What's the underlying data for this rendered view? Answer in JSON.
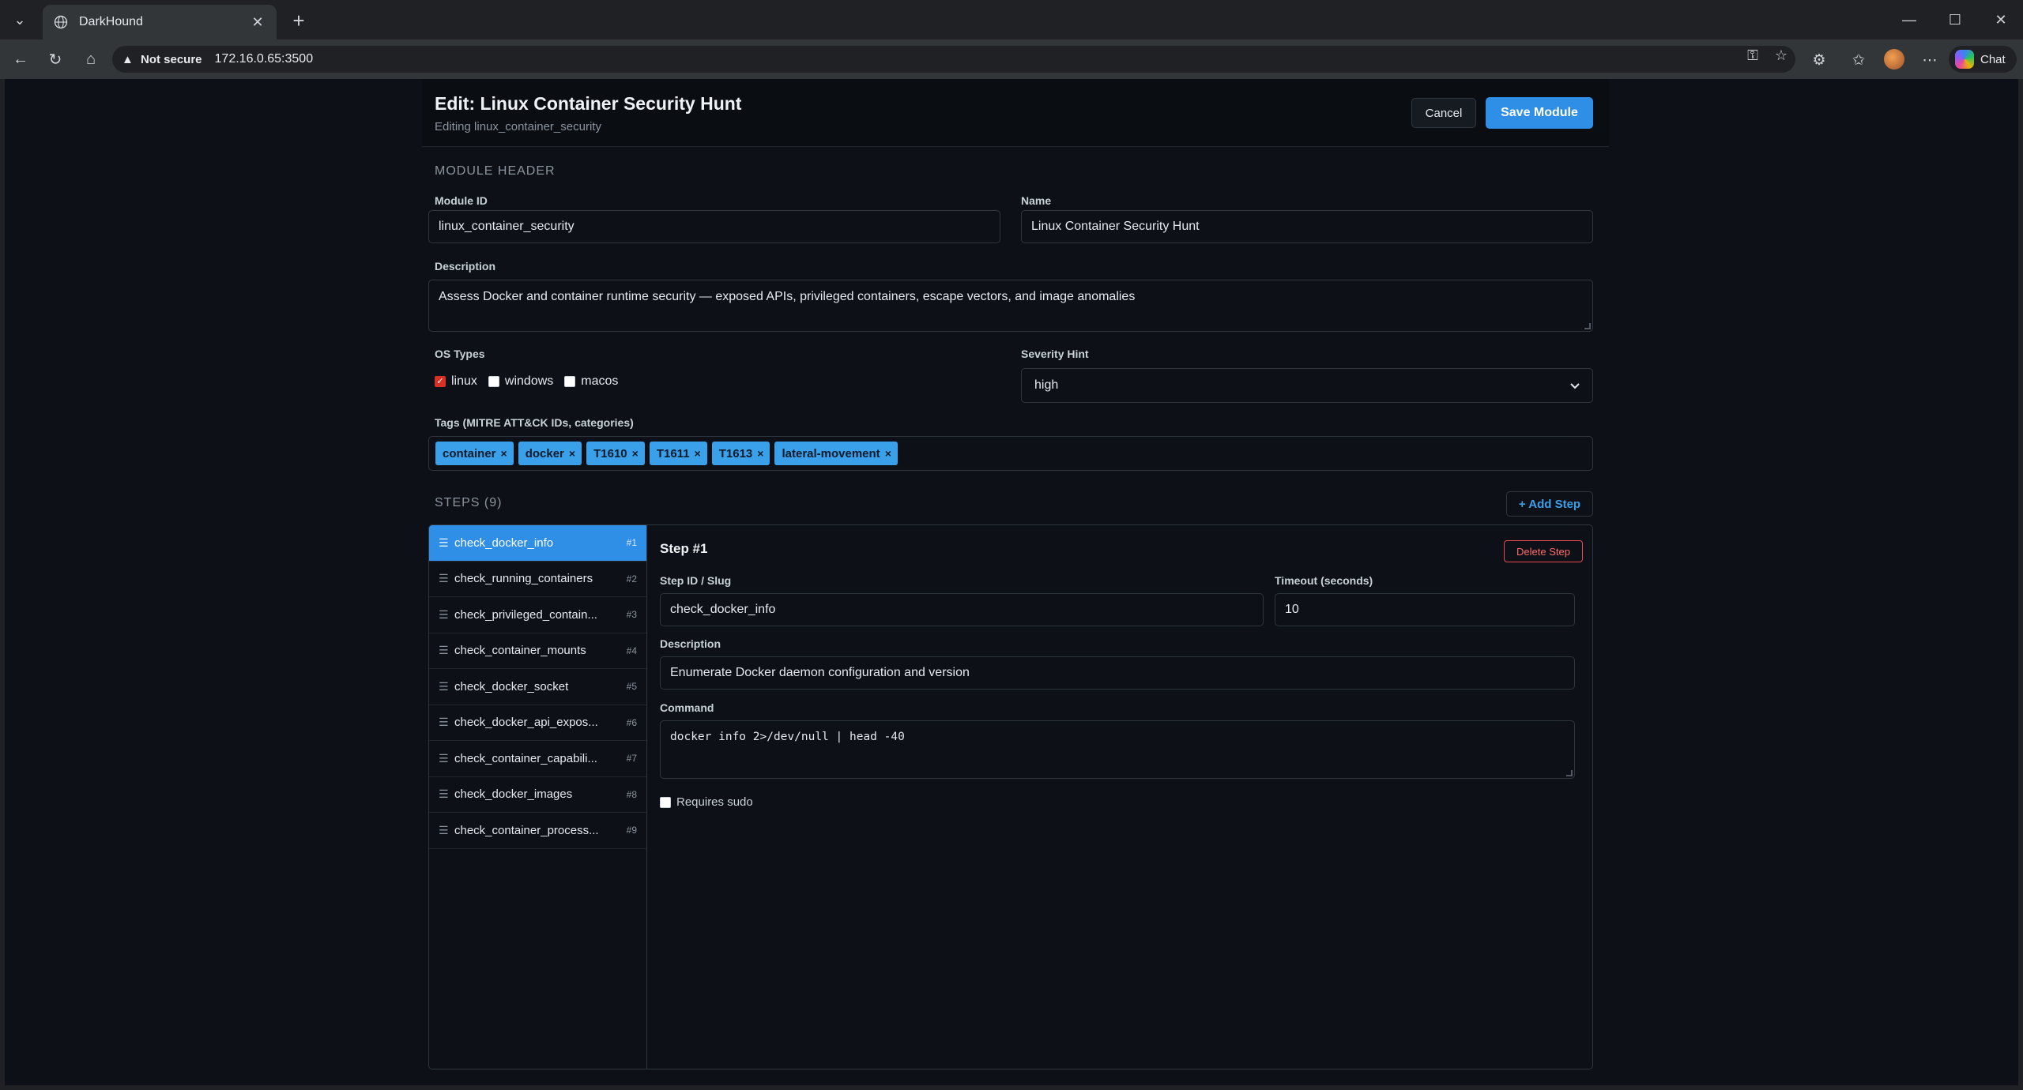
{
  "browser": {
    "tab_title": "DarkHound",
    "security_label": "Not secure",
    "url": "172.16.0.65:3500",
    "chat_label": "Chat"
  },
  "header": {
    "title": "Edit: Linux Container Security Hunt",
    "subtitle": "Editing linux_container_security",
    "cancel_label": "Cancel",
    "save_label": "Save Module"
  },
  "module": {
    "section_title": "MODULE HEADER",
    "id_label": "Module ID",
    "id_value": "linux_container_security",
    "name_label": "Name",
    "name_value": "Linux Container Security Hunt",
    "description_label": "Description",
    "description_value": "Assess Docker and container runtime security — exposed APIs, privileged containers, escape vectors, and image anomalies",
    "os_label": "OS Types",
    "os_options": [
      {
        "label": "linux",
        "checked": true
      },
      {
        "label": "windows",
        "checked": false
      },
      {
        "label": "macos",
        "checked": false
      }
    ],
    "severity_label": "Severity Hint",
    "severity_value": "high",
    "tags_label": "Tags (MITRE ATT&CK IDs, categories)",
    "tags": [
      "container",
      "docker",
      "T1610",
      "T1611",
      "T1613",
      "lateral-movement"
    ],
    "tag_remove_glyph": "×"
  },
  "steps": {
    "title": "STEPS (9)",
    "add_label": "+ Add Step",
    "items": [
      {
        "name": "check_docker_info",
        "num": "#1"
      },
      {
        "name": "check_running_containers",
        "num": "#2"
      },
      {
        "name": "check_privileged_contain...",
        "num": "#3"
      },
      {
        "name": "check_container_mounts",
        "num": "#4"
      },
      {
        "name": "check_docker_socket",
        "num": "#5"
      },
      {
        "name": "check_docker_api_expos...",
        "num": "#6"
      },
      {
        "name": "check_container_capabili...",
        "num": "#7"
      },
      {
        "name": "check_docker_images",
        "num": "#8"
      },
      {
        "name": "check_container_process...",
        "num": "#9"
      }
    ],
    "selected": {
      "heading": "Step #1",
      "delete_label": "Delete Step",
      "id_label": "Step ID / Slug",
      "id_value": "check_docker_info",
      "timeout_label": "Timeout (seconds)",
      "timeout_value": "10",
      "description_label": "Description",
      "description_value": "Enumerate Docker daemon configuration and version",
      "command_label": "Command",
      "command_value": "docker info 2>/dev/null | head -40",
      "sudo_label": "Requires sudo",
      "sudo_checked": false
    }
  },
  "colors": {
    "accent": "#2f8ee6",
    "tag": "#3aa0ea",
    "danger": "#e5484d",
    "page_bg": "#0d1117"
  }
}
